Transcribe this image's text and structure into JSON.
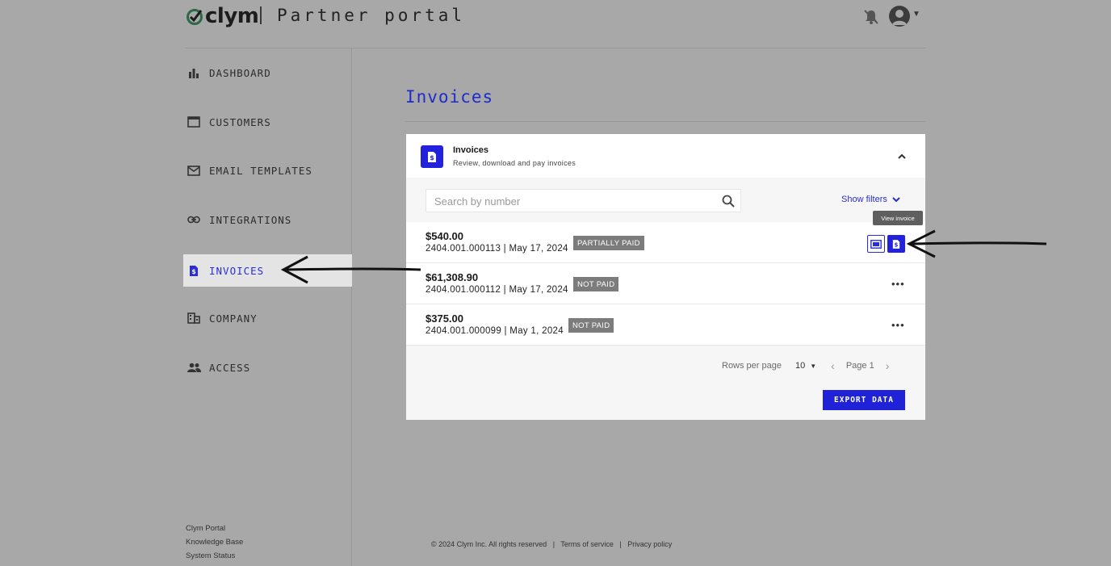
{
  "header": {
    "logo_text": "clym",
    "portal_title": "Partner portal"
  },
  "sidebar": {
    "items": [
      {
        "label": "DASHBOARD",
        "icon": "bar-chart-icon"
      },
      {
        "label": "CUSTOMERS",
        "icon": "window-icon"
      },
      {
        "label": "EMAIL TEMPLATES",
        "icon": "mail-icon"
      },
      {
        "label": "INTEGRATIONS",
        "icon": "link-icon"
      },
      {
        "label": "INVOICES",
        "icon": "invoice-icon",
        "active": true
      },
      {
        "label": "COMPANY",
        "icon": "building-icon"
      },
      {
        "label": "ACCESS",
        "icon": "people-icon"
      }
    ],
    "footer_links": [
      "Clym Portal",
      "Knowledge Base",
      "System Status"
    ]
  },
  "main": {
    "page_title": "Invoices",
    "card": {
      "title": "Invoices",
      "subtitle": "Review, download and pay invoices",
      "search_placeholder": "Search by number",
      "filters_label": "Show filters",
      "tooltip": "View invoice",
      "rows": [
        {
          "amount": "$540.00",
          "meta": "2404.001.000113 | May 17, 2024",
          "status": "PARTIALLY PAID"
        },
        {
          "amount": "$61,308.90",
          "meta": "2404.001.000112 | May 17, 2024",
          "status": "NOT PAID"
        },
        {
          "amount": "$375.00",
          "meta": "2404.001.000099 | May 1, 2024",
          "status": "NOT PAID"
        }
      ],
      "pagination": {
        "rows_per_page_label": "Rows per page",
        "rows_per_page_value": "10",
        "page_label": "Page 1"
      },
      "export_label": "EXPORT DATA"
    }
  },
  "footer": {
    "copyright": "© 2024 Clym Inc. All rights reserved",
    "terms": "Terms of service",
    "privacy": "Privacy policy"
  },
  "colors": {
    "accent": "#2222dd",
    "overlay_bg": "#a8a8a8",
    "badge": "#7c7c7c"
  }
}
